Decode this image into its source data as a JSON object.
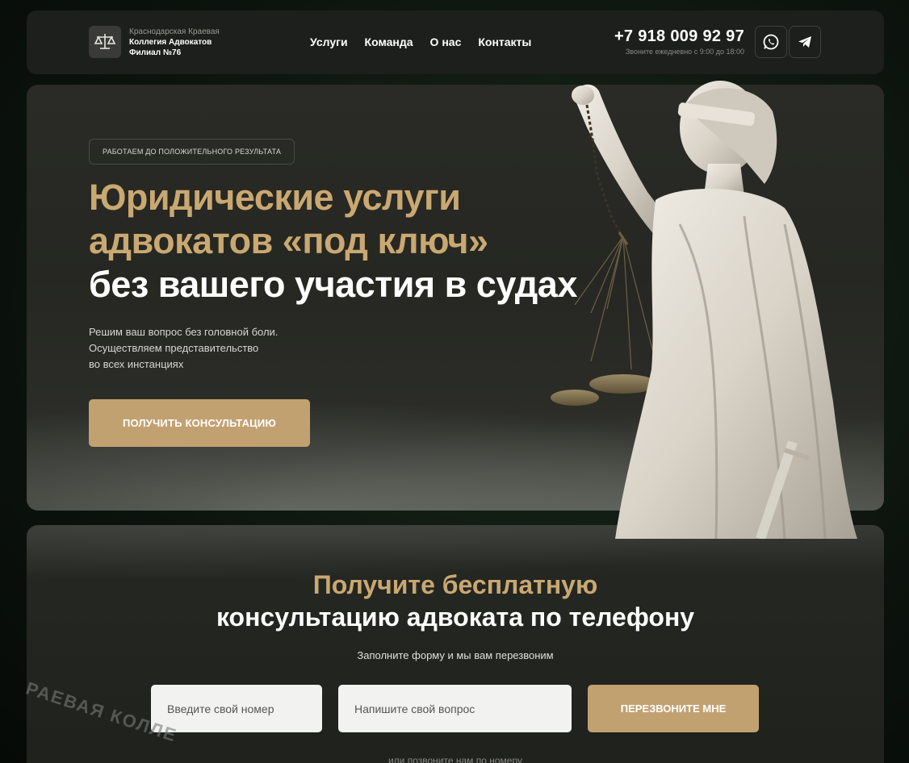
{
  "header": {
    "logo_line1": "Краснодарская Краевая",
    "logo_line2": "Коллегия Адвокатов",
    "logo_line3": "Филиал №76",
    "nav": [
      "Услуги",
      "Команда",
      "О нас",
      "Контакты"
    ],
    "phone": "+7 918 009 92 97",
    "hours": "Звоните ежедневно с 9:00 до 18:00",
    "social": [
      "whatsapp-icon",
      "telegram-icon"
    ]
  },
  "hero": {
    "badge": "РАБОТАЕМ ДО ПОЛОЖИТЕЛЬНОГО РЕЗУЛЬТАТА",
    "title_gold_1": "Юридические услуги",
    "title_gold_2": "адвокатов «под ключ»",
    "title_white": "без вашего участия в судах",
    "sub_1": "Решим ваш вопрос без головной боли.",
    "sub_2": "Осуществляем представительство",
    "sub_3": "во всех инстанциях",
    "cta": "ПОЛУЧИТЬ КОНСУЛЬТАЦИЮ"
  },
  "form": {
    "title_gold": "Получите бесплатную",
    "title_white": "консультацию адвоката по телефону",
    "desc": "Заполните форму и мы вам перезвоним",
    "phone_placeholder": "Введите свой номер",
    "question_placeholder": "Напишите свой вопрос",
    "submit": "ПЕРЕЗВОНИТЕ МНЕ",
    "alt": "или позвоните нам по номеру"
  },
  "seal_text": "РАЕВАЯ КОЛЛЕ",
  "colors": {
    "accent": "#c2a171",
    "gold_text": "#c9a871",
    "card": "#1d1f1c"
  }
}
